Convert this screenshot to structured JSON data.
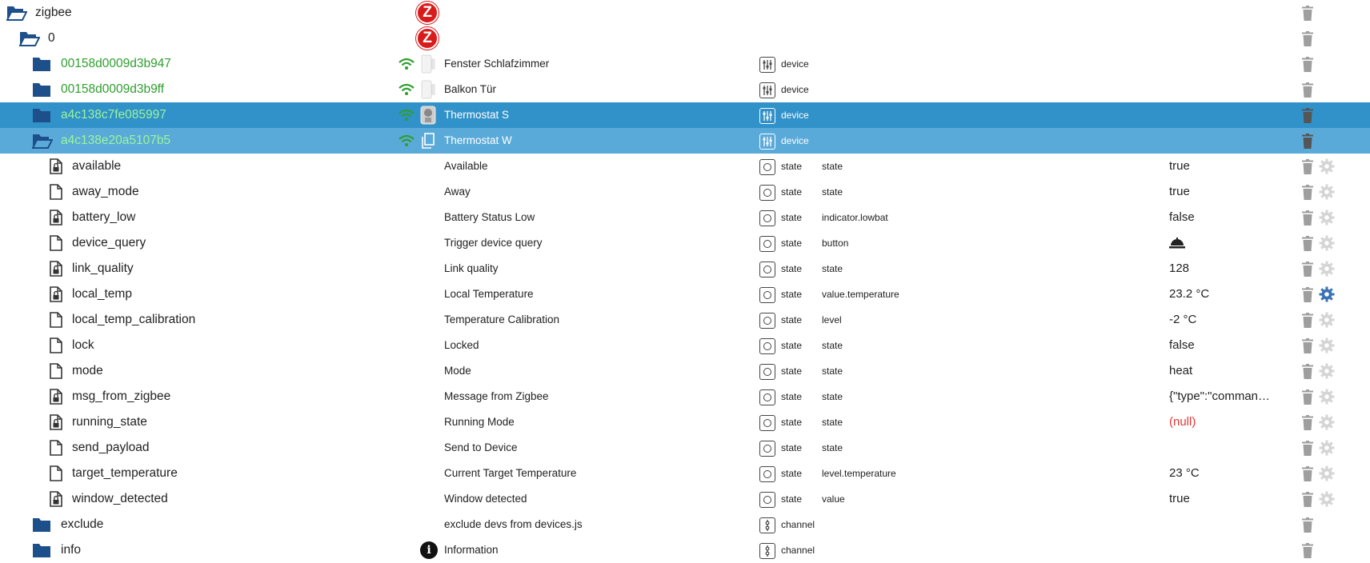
{
  "top": [
    {
      "label": "zigbee",
      "open": true,
      "logo": "zigbee-logo",
      "logo_letter": "Z"
    },
    {
      "label": "0",
      "open": true,
      "logo": "zigbee-logo",
      "logo_letter": "Z"
    }
  ],
  "devices": [
    {
      "id": "00158d0009d3b947",
      "name": "Fenster Schlafzimmer",
      "type": "device",
      "wifi": "wifi-icon",
      "thumb": "contact-sensor-thumb",
      "open": false,
      "selected": ""
    },
    {
      "id": "00158d0009d3b9ff",
      "name": "Balkon Tür",
      "type": "device",
      "wifi": "wifi-icon",
      "thumb": "contact-sensor-thumb",
      "open": false,
      "selected": ""
    },
    {
      "id": "a4c138c7fe085997",
      "name": "Thermostat S",
      "type": "device",
      "wifi": "wifi-icon",
      "thumb": "thermostat-thumb",
      "open": false,
      "selected": "sel1"
    },
    {
      "id": "a4c138e20a5107b5",
      "name": "Thermostat W",
      "type": "device",
      "wifi": "wifi-icon",
      "thumb": "copy-icon",
      "open": true,
      "selected": "sel2"
    }
  ],
  "states": [
    {
      "id": "available",
      "name": "Available",
      "type": "state",
      "role": "state",
      "value": "true",
      "locked": true
    },
    {
      "id": "away_mode",
      "name": "Away",
      "type": "state",
      "role": "state",
      "value": "true",
      "locked": false
    },
    {
      "id": "battery_low",
      "name": "Battery Status Low",
      "type": "state",
      "role": "indicator.lowbat",
      "value": "false",
      "locked": true
    },
    {
      "id": "device_query",
      "name": "Trigger device query",
      "type": "state",
      "role": "button",
      "value": "",
      "button": true,
      "locked": false
    },
    {
      "id": "link_quality",
      "name": "Link quality",
      "type": "state",
      "role": "state",
      "value": "128",
      "locked": true
    },
    {
      "id": "local_temp",
      "name": "Local Temperature",
      "type": "state",
      "role": "value.temperature",
      "value": "23.2 °C",
      "locked": true,
      "gear_active": true
    },
    {
      "id": "local_temp_calibration",
      "name": "Temperature Calibration",
      "type": "state",
      "role": "level",
      "value": "-2 °C",
      "locked": false
    },
    {
      "id": "lock",
      "name": "Locked",
      "type": "state",
      "role": "state",
      "value": "false",
      "locked": false
    },
    {
      "id": "mode",
      "name": "Mode",
      "type": "state",
      "role": "state",
      "value": "heat",
      "locked": false
    },
    {
      "id": "msg_from_zigbee",
      "name": "Message from Zigbee",
      "type": "state",
      "role": "state",
      "value": "{\"type\":\"comman…",
      "locked": true
    },
    {
      "id": "running_state",
      "name": "Running Mode",
      "type": "state",
      "role": "state",
      "value": "(null)",
      "null": true,
      "locked": true
    },
    {
      "id": "send_payload",
      "name": "Send to Device",
      "type": "state",
      "role": "state",
      "value": "",
      "locked": false
    },
    {
      "id": "target_temperature",
      "name": "Current Target Temperature",
      "type": "state",
      "role": "level.temperature",
      "value": "23 °C",
      "locked": false
    },
    {
      "id": "window_detected",
      "name": "Window detected",
      "type": "state",
      "role": "value",
      "value": "true",
      "locked": true
    }
  ],
  "channels": [
    {
      "id": "exclude",
      "name": "exclude devs from devices.js",
      "type": "channel",
      "icon": ""
    },
    {
      "id": "info",
      "name": "Information",
      "type": "channel",
      "icon": "info-icon",
      "icon_glyph": "i"
    }
  ],
  "colors": {
    "selected_primary": "#3191c9",
    "selected_secondary": "#5aaad9",
    "id_green": "#2e9e2e",
    "folder": "#1d4f8a",
    "null_red": "#e53935"
  }
}
